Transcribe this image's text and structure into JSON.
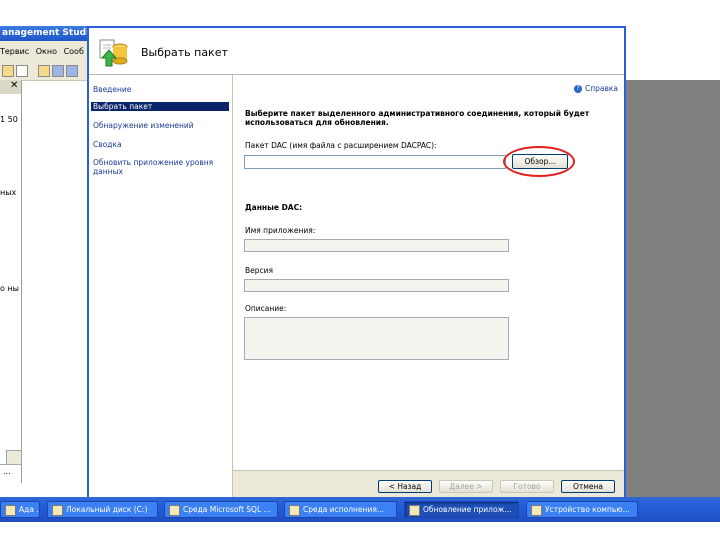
{
  "background_app": {
    "title": "anagement Studio",
    "menu": [
      "Tервис",
      "Окно",
      "Сооб"
    ],
    "panel_close": "✕",
    "fragments": [
      "1 50",
      "ных",
      "о ны"
    ],
    "status_text": "..."
  },
  "dialog": {
    "title": "Выбрать пакет",
    "nav": [
      "Введение",
      "Выбрать пакет",
      "Обнаружение изменений",
      "Сводка",
      "Обновить приложение уровня данных"
    ],
    "help": "Справка",
    "instruction": "Выберите пакет выделенного административного соединения, который будет использоваться для обновления.",
    "package_label": "Пакет DAC (имя файла с расширением DACPAC):",
    "package_value": "",
    "browse": "Обзор...",
    "dac_data_title": "Данные DAC:",
    "app_name_label": "Имя приложения:",
    "version_label": "Версия",
    "description_label": "Описание:",
    "buttons": {
      "back": "< Назад",
      "next": "Далее >",
      "finish": "Готово",
      "cancel": "Отмена"
    }
  },
  "taskbar": {
    "tasks": [
      "Ада ...",
      "Локальный диск (C:)",
      "Среда Microsoft SQL ...",
      "Среда исполнения...",
      "Обновление прилож...",
      "Устройство компью..."
    ]
  },
  "colors": {
    "taskbar": "#245cd8",
    "selection": "#0a246a",
    "highlight": "#e0201c"
  }
}
